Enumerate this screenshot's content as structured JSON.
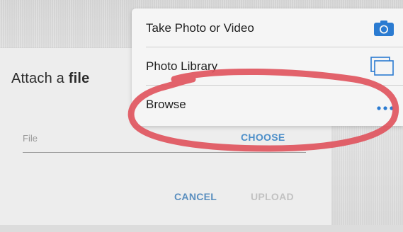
{
  "dialog": {
    "title_prefix": "Attach a",
    "title_bold": "file",
    "file_field_label": "File",
    "choose_label": "CHOOSE",
    "cancel_label": "CANCEL",
    "upload_label": "UPLOAD"
  },
  "action_sheet": {
    "items": [
      {
        "label": "Take Photo or Video",
        "icon": "camera-icon"
      },
      {
        "label": "Photo Library",
        "icon": "photo-library-icon"
      },
      {
        "label": "Browse",
        "icon": "more-dots-icon"
      }
    ]
  },
  "colors": {
    "accent_blue": "#2b7bd1",
    "button_blue": "#4d8fc9",
    "disabled_gray": "#c2c2c2",
    "annotation_red": "#e0555e"
  }
}
